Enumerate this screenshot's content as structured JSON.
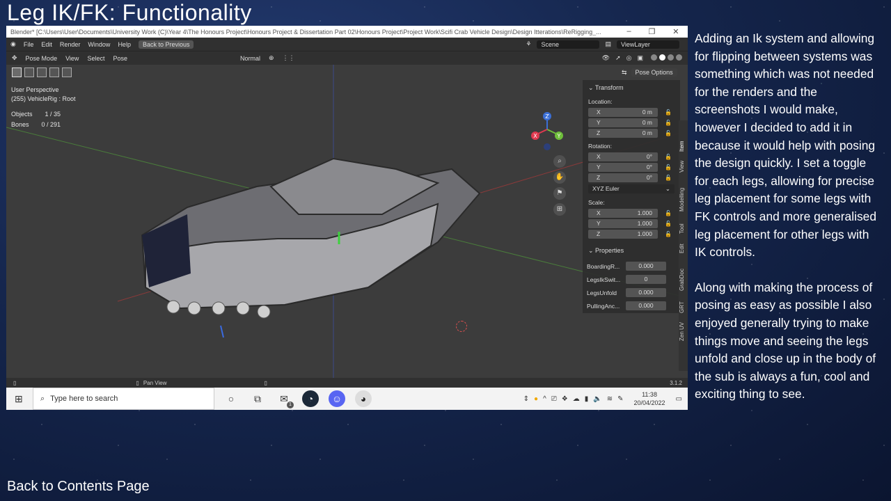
{
  "slide": {
    "title": "Leg IK/FK: Functionality",
    "back_link": "Back to Contents Page",
    "paragraphs": [
      "Adding an Ik system and allowing for flipping between systems was something which was not needed for the renders and the screenshots I would make, however I decided to add it in because it would help with posing the design quickly. I set a toggle for each legs, allowing for precise leg placement for some legs with FK controls and more generalised leg placement for other legs with IK controls.",
      "Along with making the process of posing as easy as possible I also enjoyed generally trying to make things move and seeing the legs unfold and close up in the body of the sub is always a fun, cool and exciting thing to see."
    ]
  },
  "blender": {
    "window_title": "Blender* [C:\\Users\\User\\Documents\\University Work (C)\\Year 4\\The Honours Project\\Honours Project & Dissertation Part 02\\Honours Project\\Project Work\\Scifi Crab Vehicle Design\\Design Itterations\\ReRigging_...",
    "menu": [
      "File",
      "Edit",
      "Render",
      "Window",
      "Help"
    ],
    "back_to_previous": "Back to Previous",
    "scene": "Scene",
    "view_layer": "ViewLayer",
    "mode": "Pose Mode",
    "header_menu": [
      "View",
      "Select",
      "Pose"
    ],
    "orientation": "Normal",
    "pose_options": "Pose Options",
    "viewport": {
      "perspective": "User Perspective",
      "object": "(255) VehicleRig : Root",
      "objects_label": "Objects",
      "objects_value": "1 / 35",
      "bones_label": "Bones",
      "bones_value": "0 / 291"
    },
    "transform": {
      "title": "Transform",
      "location_label": "Location:",
      "location": [
        {
          "axis": "X",
          "value": "0 m"
        },
        {
          "axis": "Y",
          "value": "0 m"
        },
        {
          "axis": "Z",
          "value": "0 m"
        }
      ],
      "rotation_label": "Rotation:",
      "rotation": [
        {
          "axis": "X",
          "value": "0°"
        },
        {
          "axis": "Y",
          "value": "0°"
        },
        {
          "axis": "Z",
          "value": "0°"
        }
      ],
      "rotation_mode": "XYZ Euler",
      "scale_label": "Scale:",
      "scale": [
        {
          "axis": "X",
          "value": "1.000"
        },
        {
          "axis": "Y",
          "value": "1.000"
        },
        {
          "axis": "Z",
          "value": "1.000"
        }
      ]
    },
    "properties": {
      "title": "Properties",
      "items": [
        {
          "name": "BoardingR...",
          "value": "0.000"
        },
        {
          "name": "LegsIkSwit...",
          "value": "0"
        },
        {
          "name": "LegsUnfold",
          "value": "0.000"
        },
        {
          "name": "PullingAnc...",
          "value": "0.000"
        }
      ]
    },
    "tabs": [
      "Item",
      "View",
      "Modelling",
      "Tool",
      "Edit",
      "GrabDoc",
      "GRT",
      "Zen UV"
    ],
    "status": {
      "center": "Pan View",
      "version": "3.1.2"
    }
  },
  "taskbar": {
    "search_placeholder": "Type here to search",
    "time": "11:38",
    "date": "20/04/2022",
    "mail_badge": "1"
  },
  "gizmo": {
    "x": "X",
    "y": "Y",
    "z": "Z"
  },
  "colors": {
    "x_axis": "#e0394f",
    "y_axis": "#6fbf3b",
    "z_axis": "#3b6fd6"
  }
}
